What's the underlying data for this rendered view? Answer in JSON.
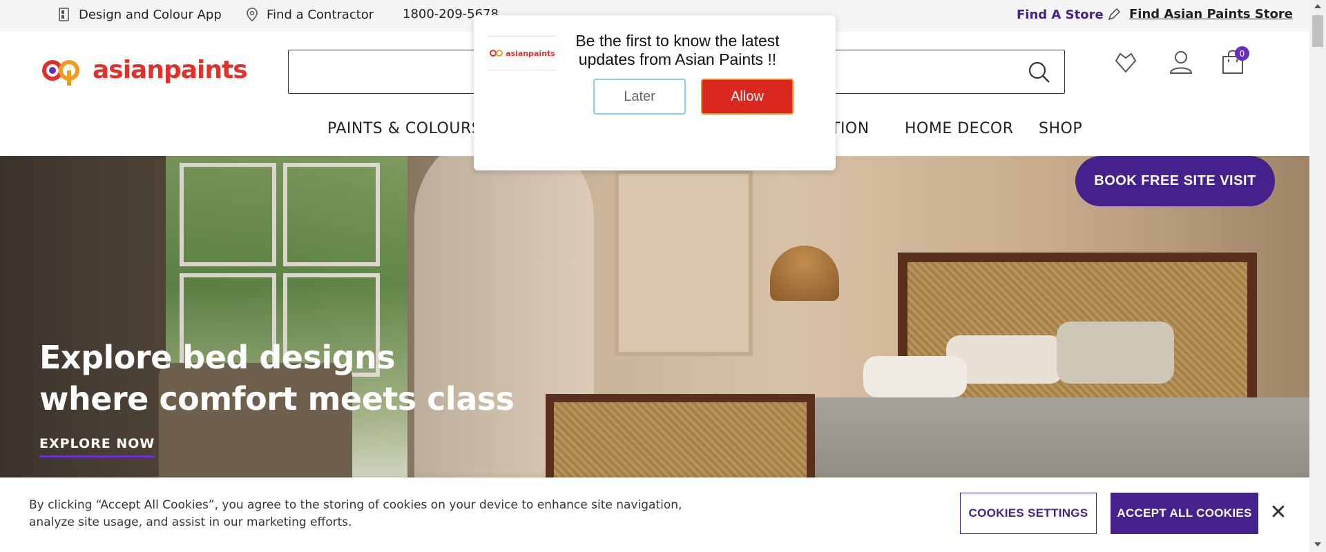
{
  "topbar": {
    "design_app": "Design and Colour App",
    "contractor": "Find a Contractor",
    "phone": "1800-209-5678",
    "find_store": "Find A Store",
    "find_ap_store": "Find Asian Paints Store"
  },
  "header": {
    "logo_text": "asianpaints",
    "search_placeholder": "",
    "cart_count": "0",
    "nav": [
      "PAINTS & COLOURS",
      "TION",
      "HOME DECOR",
      "SHOP"
    ]
  },
  "hero": {
    "title_line1": "Explore bed designs",
    "title_line2": "where comfort meets class",
    "cta": "EXPLORE NOW"
  },
  "book_visit": "BOOK FREE SITE VISIT",
  "popup": {
    "logo_text": "asianpaints",
    "message": "Be the first to know the latest updates from Asian Paints !!",
    "later": "Later",
    "allow": "Allow"
  },
  "cookies": {
    "text": "By clicking “Accept All Cookies”, you agree to the storing of cookies on your device to enhance site navigation, analyze site usage, and assist in our marketing efforts.",
    "settings": "COOKIES SETTINGS",
    "accept": "ACCEPT ALL COOKIES",
    "close": "✕"
  },
  "colors": {
    "brand_red": "#e2312b",
    "brand_purple": "#45218c",
    "allow_red": "#d9281f"
  }
}
